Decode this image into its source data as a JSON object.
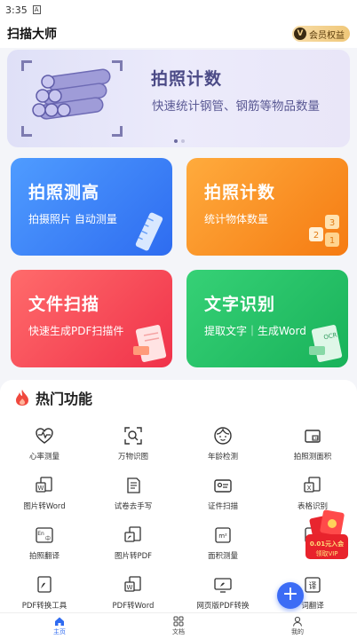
{
  "status_bar": {
    "time": "3:35",
    "notif_icon": "a-icon"
  },
  "header": {
    "title": "扫描大师",
    "vip_label": "会员权益",
    "vip_letter": "V"
  },
  "banner": {
    "title": "拍照计数",
    "subtitle": "快速统计钢管、钢筋等物品数量",
    "dots": 2,
    "active_dot": 0
  },
  "cards": [
    {
      "title": "拍照测高",
      "subtitle": "拍摄照片 自动测量",
      "icon": "ruler-icon"
    },
    {
      "title": "拍照计数",
      "subtitle": "统计物体数量",
      "icon": "number-blocks-icon"
    },
    {
      "title": "文件扫描",
      "subtitle": "快速生成PDF扫描件",
      "icon": "pdf-doc-icon"
    },
    {
      "title": "文字识别",
      "subtitle": "提取文字｜生成Word",
      "icon": "ocr-doc-icon"
    }
  ],
  "hot": {
    "title": "热门功能",
    "items": [
      {
        "label": "心率测量",
        "icon": "heart-pulse-icon"
      },
      {
        "label": "万物识图",
        "icon": "scan-search-icon"
      },
      {
        "label": "年龄检测",
        "icon": "face-icon"
      },
      {
        "label": "拍照测面积",
        "icon": "area-measure-icon"
      },
      {
        "label": "图片转Word",
        "icon": "image-to-word-icon"
      },
      {
        "label": "试卷去手写",
        "icon": "exam-paper-icon"
      },
      {
        "label": "证件扫描",
        "icon": "id-card-icon"
      },
      {
        "label": "表格识别",
        "icon": "table-icon"
      },
      {
        "label": "拍照翻译",
        "icon": "translate-icon"
      },
      {
        "label": "图片转PDF",
        "icon": "image-to-pdf-icon"
      },
      {
        "label": "面积测量",
        "icon": "area-icon"
      },
      {
        "label": "证",
        "icon": "cert-icon"
      },
      {
        "label": "PDF转换工具",
        "icon": "pdf-tool-icon"
      },
      {
        "label": "PDF转Word",
        "icon": "pdf-to-word-icon"
      },
      {
        "label": "网页版PDF转换",
        "icon": "web-pdf-icon"
      },
      {
        "label": "词翻译",
        "icon": "word-translate-icon"
      }
    ]
  },
  "promo": {
    "text_top": "0.01元入会",
    "text_bottom": "领取VIP"
  },
  "fab": {
    "label": "+"
  },
  "tabs": [
    {
      "label": "主页",
      "icon": "home-icon",
      "active": true
    },
    {
      "label": "文档",
      "icon": "grid-icon",
      "active": false
    },
    {
      "label": "我的",
      "icon": "user-icon",
      "active": false
    }
  ],
  "colors": {
    "accent": "#2f6bf1",
    "banner_text": "#4b4a86",
    "hot_icon": "#f0483e"
  }
}
